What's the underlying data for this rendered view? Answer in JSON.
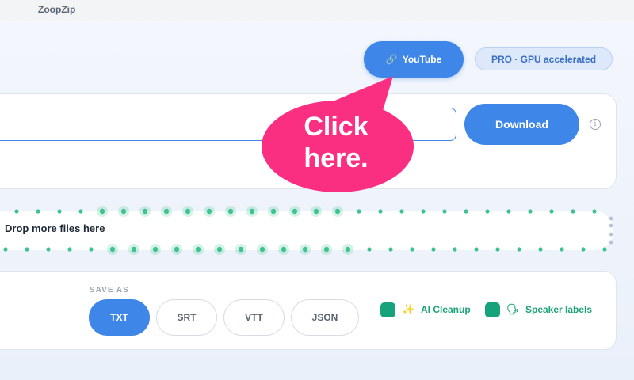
{
  "app": {
    "title": "ZoopZip"
  },
  "header": {
    "source_button": {
      "label": "YouTube",
      "icon": "link-icon"
    },
    "pro_badge": "PRO · GPU accelerated"
  },
  "url_input": {
    "value": "",
    "placeholder": ""
  },
  "download_button": "Download",
  "info_icon": "i",
  "drop_zone": {
    "label": "Drop more files here"
  },
  "save_as": {
    "label": "SAVE AS",
    "formats": [
      "TXT",
      "SRT",
      "VTT",
      "JSON"
    ],
    "selected": "TXT"
  },
  "options": [
    {
      "label": "AI Cleanup",
      "emoji": "✨",
      "checked": true
    },
    {
      "label": "Speaker labels",
      "emoji": "🗣",
      "checked": true
    }
  ],
  "callout": {
    "line1": "Click",
    "line2": "here."
  },
  "colors": {
    "accent": "#3e86e8",
    "option_green": "#16a37b",
    "callout_pink": "#fb2f82",
    "dot_green": "#3ec28f"
  }
}
